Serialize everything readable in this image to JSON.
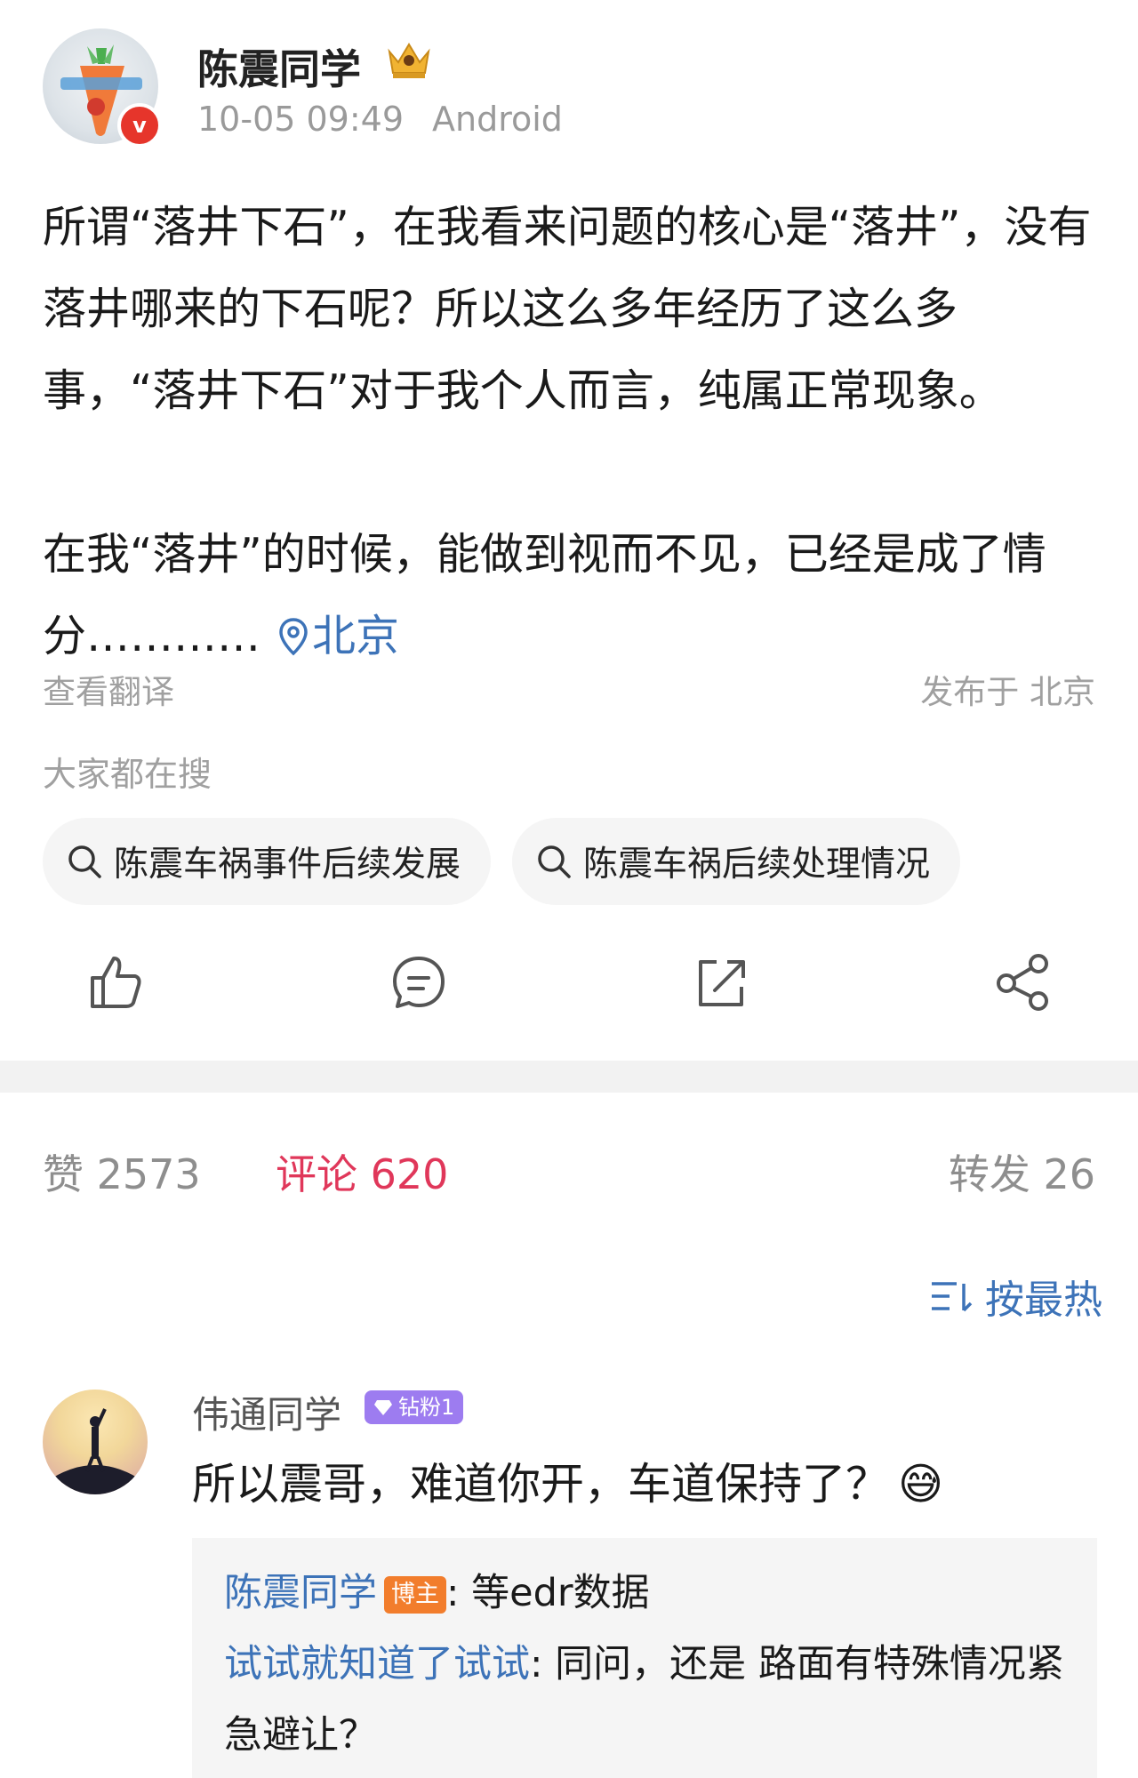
{
  "post": {
    "author": "陈震同学",
    "time": "10-05 09:49",
    "device": "Android",
    "paragraph1": "所谓“落井下石”，在我看来问题的核心是“落井”，没有落井哪来的下石呢？所以这么多年经历了这么多事，“落井下石”对于我个人而言，纯属正常现象。",
    "paragraph2": "在我“落井”的时候，能做到视而不见，已经是成了情分…………",
    "location_link": "北京",
    "translate": "查看翻译",
    "published_location": "发布于 北京"
  },
  "trending": {
    "label": "大家都在搜",
    "queries": [
      "陈震车祸事件后续发展",
      "陈震车祸后续处理情况"
    ]
  },
  "actions": {
    "icons": [
      "thumbs-up-icon",
      "comment-icon",
      "repost-icon",
      "share-icon"
    ]
  },
  "stats": {
    "likes": "赞 2573",
    "comments": "评论 620",
    "reposts": "转发 26"
  },
  "sort": {
    "label": "按最热"
  },
  "comment": {
    "user": "伟通同学",
    "fan_badge": "钻粉1",
    "text": "所以震哥，难道你开，车道保持了？",
    "emoji": "😅",
    "replies": [
      {
        "user": "陈震同学",
        "badge": "博主",
        "text": ": 等edr数据"
      },
      {
        "user": "试试就知道了试试",
        "text": ": 同问，还是 路面有特殊情况紧急避让？"
      }
    ]
  },
  "colors": {
    "link": "#3d73b8",
    "active_tab": "#e0375a",
    "verified": "#e6352b",
    "host_badge": "#f27d2c",
    "fan_badge": "#9d7cf0"
  }
}
